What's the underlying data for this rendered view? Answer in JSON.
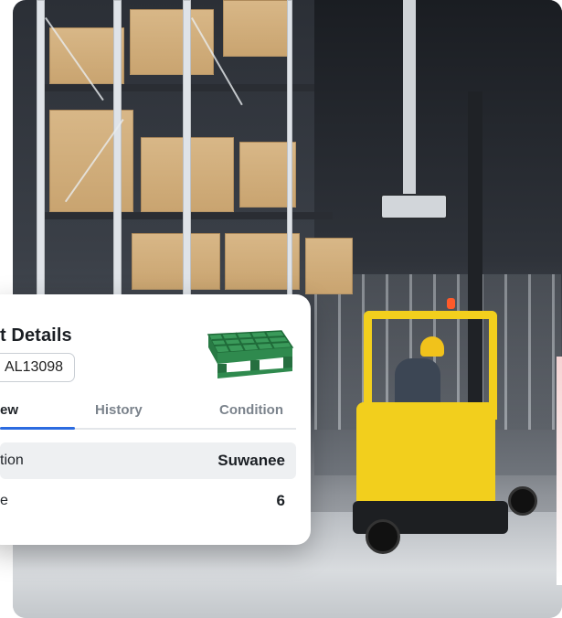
{
  "card": {
    "title": "t Details",
    "asset_id": "AL13098",
    "tabs": [
      {
        "label": "ew",
        "active": true
      },
      {
        "label": "History",
        "active": false
      },
      {
        "label": "Condition",
        "active": false
      }
    ],
    "rows": [
      {
        "key": "tion",
        "value": "Suwanee"
      },
      {
        "key": "e",
        "value": "6"
      }
    ]
  },
  "colors": {
    "accent": "#2c6be0",
    "pallet_green": "#2f8a4e",
    "forklift_yellow": "#f2cf1d"
  },
  "icons": {
    "pallet": "pallet-icon"
  }
}
